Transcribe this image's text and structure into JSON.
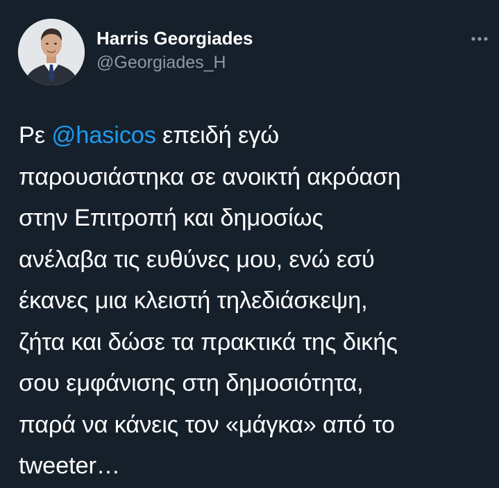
{
  "author": {
    "display_name": "Harris Georgiades",
    "handle": "@Georgiades_H",
    "avatar_icon": "profile-photo"
  },
  "menu": {
    "icon": "more-horizontal-icon"
  },
  "tweet": {
    "line_1": {
      "before": "Ρε ",
      "mention": "@hasicos",
      "after": " επειδή εγώ"
    },
    "line_2": "παρουσιάστηκα σε ανοικτή ακρόαση",
    "line_3": "στην Επιτροπή και δημοσίως",
    "line_4": "ανέλαβα τις ευθύνες μου, ενώ εσύ",
    "line_5": "έκανες μια κλειστή τηλεδιάσκεψη,",
    "line_6": "ζήτα και δώσε τα πρακτικά της δικής",
    "line_7": "σου εμφάνισης στη δημοσιότητα,",
    "line_8": "παρά να κάνεις τον «μάγκα» από το",
    "line_9": "tweeter…"
  },
  "colors": {
    "background": "#15202b",
    "text": "#ffffff",
    "secondary_text": "#8b98a5",
    "mention": "#1d9bf0"
  }
}
